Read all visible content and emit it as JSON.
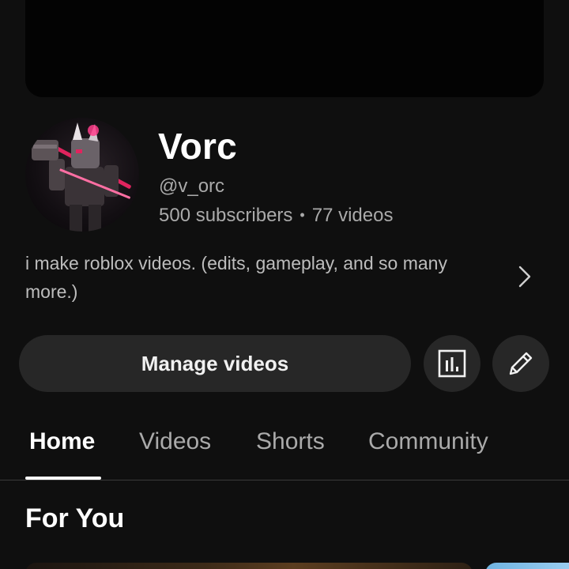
{
  "channel": {
    "name": "Vorc",
    "handle": "@v_orc",
    "subscribers": "500 subscribers",
    "separator": "•",
    "videos": "77 videos",
    "description": "i make roblox videos. (edits, gameplay, and so many more.)"
  },
  "actions": {
    "manage_label": "Manage videos",
    "analytics_icon": "analytics-icon",
    "edit_icon": "pencil-icon"
  },
  "tabs": [
    {
      "label": "Home",
      "active": true
    },
    {
      "label": "Videos",
      "active": false
    },
    {
      "label": "Shorts",
      "active": false
    },
    {
      "label": "Community",
      "active": false
    }
  ],
  "section": {
    "title": "For You"
  },
  "colors": {
    "background": "#0f0f0f",
    "button": "#272727",
    "text_primary": "#ffffff",
    "text_secondary": "#aaaaaa",
    "avatar_accent": "#e0245e"
  }
}
